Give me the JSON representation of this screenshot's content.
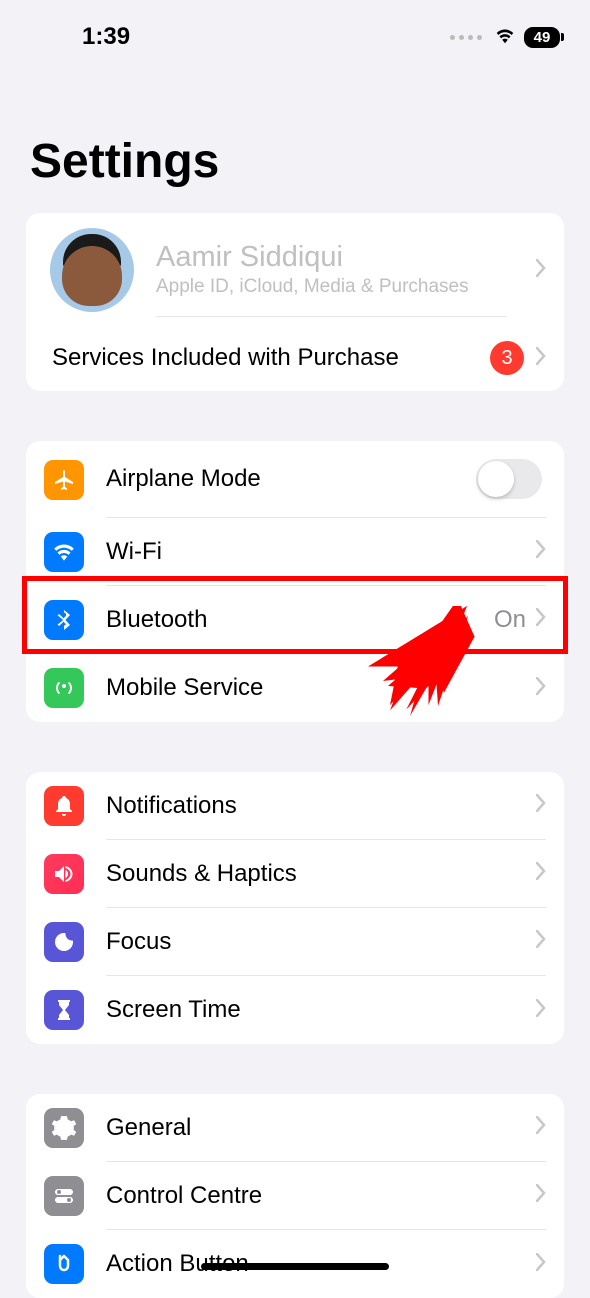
{
  "status": {
    "time": "1:39",
    "battery": "49"
  },
  "title": "Settings",
  "profile": {
    "name": "Aamir Siddiqui",
    "subtitle": "Apple ID, iCloud, Media & Purchases"
  },
  "services": {
    "label": "Services Included with Purchase",
    "badge": "3"
  },
  "group1": {
    "airplane": "Airplane Mode",
    "wifi": "Wi-Fi",
    "bluetooth": "Bluetooth",
    "bluetooth_value": "On",
    "mobile": "Mobile Service"
  },
  "group2": {
    "notifications": "Notifications",
    "sounds": "Sounds & Haptics",
    "focus": "Focus",
    "screentime": "Screen Time"
  },
  "group3": {
    "general": "General",
    "control": "Control Centre",
    "action": "Action Button"
  }
}
